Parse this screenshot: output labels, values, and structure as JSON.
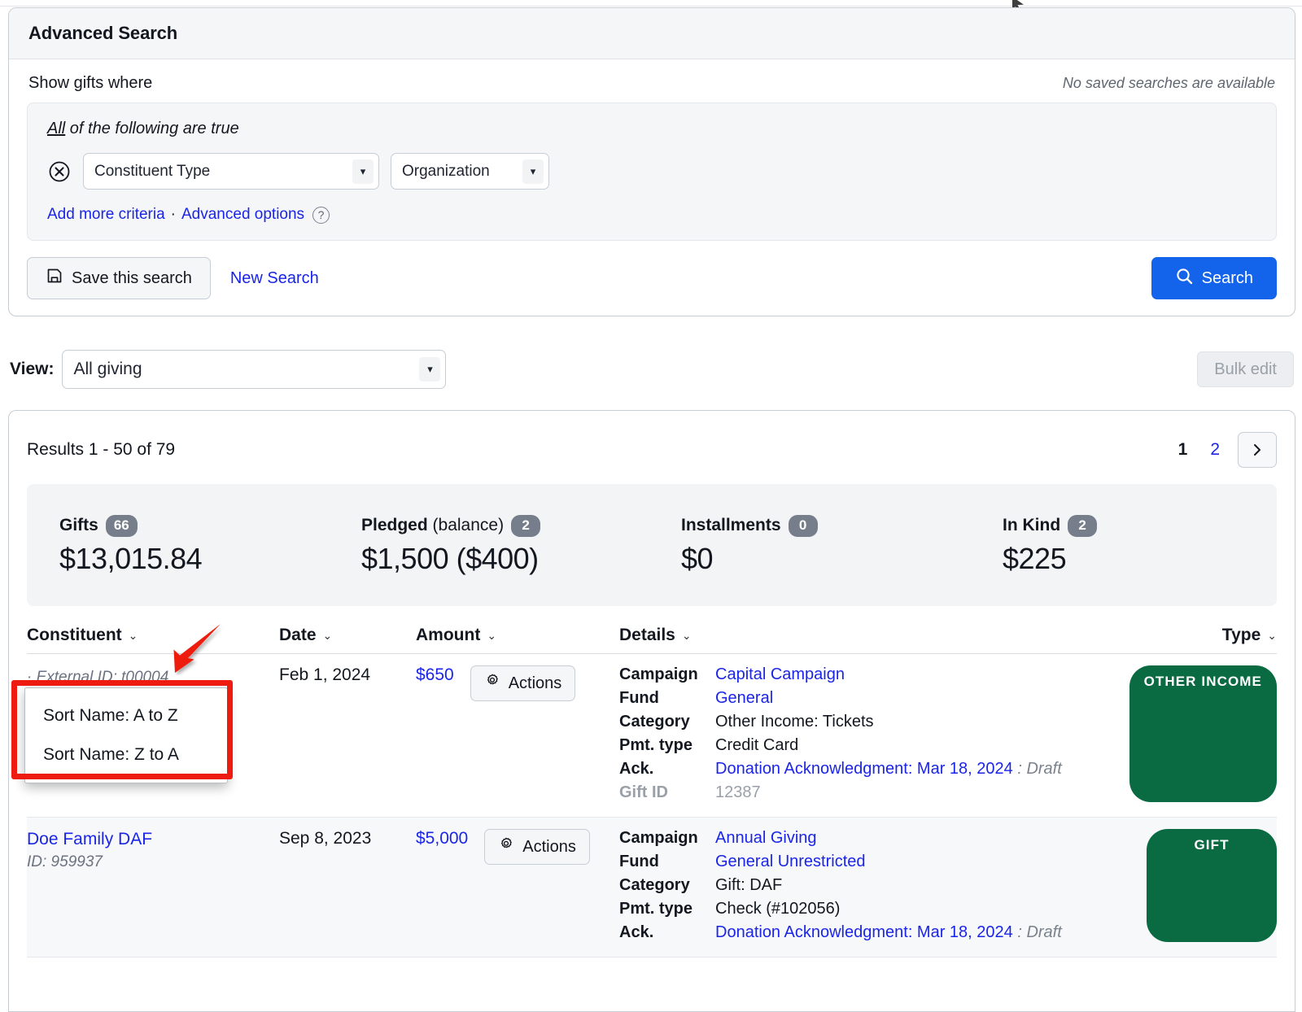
{
  "search_panel": {
    "title": "Advanced Search",
    "show_label": "Show gifts where",
    "no_saved_searches": "No saved searches are available",
    "all_true_prefix": "All",
    "all_true_rest": " of the following are true",
    "criteria": [
      {
        "field": "Constituent Type",
        "value": "Organization",
        "remove_icon": "remove-circle-icon"
      }
    ],
    "add_more_criteria": "Add more criteria",
    "separator": "·",
    "advanced_options": "Advanced options",
    "help_icon": "help-circle-icon",
    "save_search_label": "Save this search",
    "save_icon": "save-disk-icon",
    "new_search_label": "New Search",
    "search_label": "Search",
    "search_icon": "magnifier-icon",
    "accent_color": "#1464eb",
    "link_color": "#1a25e8"
  },
  "view_bar": {
    "label": "View:",
    "value": "All giving",
    "bulk_edit_label": "Bulk edit"
  },
  "results": {
    "count_text": "Results 1 - 50 of 79",
    "pagination": {
      "pages": [
        "1",
        "2"
      ],
      "current": "1",
      "next_icon": "chevron-right-icon"
    },
    "stats": [
      {
        "name": "Gifts",
        "paren": "",
        "count": "66",
        "value": "$13,015.84"
      },
      {
        "name": "Pledged",
        "paren": " (balance)",
        "count": "2",
        "value": "$1,500 ($400)"
      },
      {
        "name": "Installments",
        "paren": "",
        "count": "0",
        "value": "$0"
      },
      {
        "name": "In Kind",
        "paren": "",
        "count": "2",
        "value": "$225"
      }
    ],
    "columns": [
      {
        "label": "Constituent",
        "caret": "⌄"
      },
      {
        "label": "Date",
        "caret": "⌄"
      },
      {
        "label": "Amount",
        "caret": "⌄"
      },
      {
        "label": "Details",
        "caret": "⌄"
      },
      {
        "label": "Type",
        "caret": "⌄"
      }
    ],
    "rows": [
      {
        "constituent": "",
        "constituent_sub": "· External ID: t00004",
        "date": "Feb 1, 2024",
        "amount": "$650",
        "actions_label": "Actions",
        "actions_icon": "gear-icon",
        "details": [
          {
            "key": "Campaign",
            "value": "Capital Campaign",
            "link": true
          },
          {
            "key": "Fund",
            "value": "General",
            "link": true
          },
          {
            "key": "Category",
            "value": "Other Income: Tickets",
            "link": false
          },
          {
            "key": "Pmt. type",
            "value": "Credit Card",
            "link": false
          },
          {
            "key": "Ack.",
            "value": "Donation Acknowledgment: Mar 18, 2024",
            "link": true,
            "status": " : Draft"
          },
          {
            "key": "Gift ID",
            "value": "12387",
            "link": false,
            "gray": true
          }
        ],
        "type_badge": "OTHER INCOME",
        "badge_color": "#0a6b43"
      },
      {
        "constituent": "Doe Family DAF",
        "constituent_sub": "ID: 959937",
        "date": "Sep 8, 2023",
        "amount": "$5,000",
        "actions_label": "Actions",
        "actions_icon": "gear-icon",
        "details": [
          {
            "key": "Campaign",
            "value": "Annual Giving",
            "link": true
          },
          {
            "key": "Fund",
            "value": "General Unrestricted",
            "link": true
          },
          {
            "key": "Category",
            "value": "Gift: DAF",
            "link": false
          },
          {
            "key": "Pmt. type",
            "value": "Check (#102056)",
            "link": false
          },
          {
            "key": "Ack.",
            "value": "Donation Acknowledgment: Mar 18, 2024",
            "link": true,
            "status": " : Draft"
          }
        ],
        "type_badge": "GIFT",
        "badge_color": "#0a6b43"
      }
    ]
  },
  "sort_menu": {
    "items": [
      "Sort Name: A to Z",
      "Sort Name: Z to A"
    ]
  },
  "annotation": {
    "color": "#ee1b11",
    "highlight_target": "constituent-sort-menu",
    "arrow_target": "constituent-column-sort-caret"
  }
}
